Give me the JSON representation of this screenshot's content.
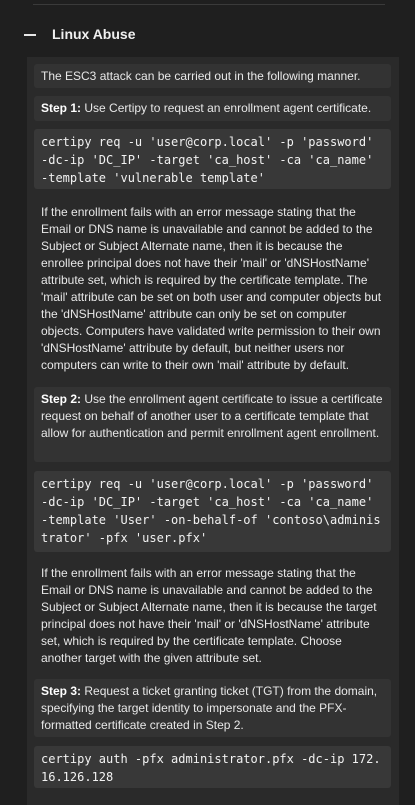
{
  "section": {
    "title": "Linux Abuse"
  },
  "intro": "The ESC3 attack can be carried out in the following manner.",
  "step1": {
    "label": "Step 1:",
    "text": " Use Certipy to request an enrollment agent certificate.",
    "code": "certipy req -u 'user@corp.local' -p 'password' -dc-ip 'DC_IP' -target 'ca_host' -ca 'ca_name' -template 'vulnerable template'",
    "note": "If the enrollment fails with an error message stating that the Email or DNS name is unavailable and cannot be added to the Subject or Subject Alternate name, then it is because the enrollee principal does not have their 'mail' or 'dNSHostName' attribute set, which is required by the certificate template. The 'mail' attribute can be set on both user and computer objects but the 'dNSHostName' attribute can only be set on computer objects. Computers have validated write permission to their own 'dNSHostName' attribute by default, but neither users nor computers can write to their own 'mail' attribute by default."
  },
  "step2": {
    "label": "Step 2:",
    "text": " Use the enrollment agent certificate to issue a certificate request on behalf of another user to a certificate template that allow for authentication and permit enrollment agent enrollment.",
    "code": "certipy req -u 'user@corp.local' -p 'password' -dc-ip 'DC_IP' -target 'ca_host' -ca 'ca_name' -template 'User' -on-behalf-of 'contoso\\administrator' -pfx 'user.pfx'",
    "note": "If the enrollment fails with an error message stating that the Email or DNS name is unavailable and cannot be added to the Subject or Subject Alternate name, then it is because the target principal does not have their 'mail' or 'dNSHostName' attribute set, which is required by the certificate template. Choose another target with the given attribute set."
  },
  "step3": {
    "label": "Step 3:",
    "text": " Request a ticket granting ticket (TGT) from the domain, specifying the target identity to impersonate and the PFX-formatted certificate created in Step 2.",
    "code": "certipy auth -pfx administrator.pfx -dc-ip 172.16.126.128"
  }
}
